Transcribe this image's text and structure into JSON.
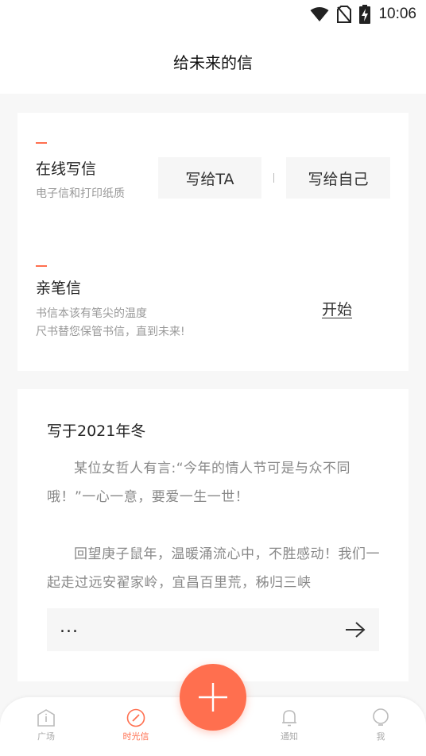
{
  "status": {
    "time": "10:06"
  },
  "header": {
    "title": "给未来的信"
  },
  "online": {
    "title": "在线写信",
    "subtitle": "电子信和打印纸质",
    "write_ta": "写给TA",
    "write_self": "写给自己"
  },
  "handwritten": {
    "title": "亲笔信",
    "subtitle_line1": "书信本该有笔尖的温度",
    "subtitle_line2": "尺书替您保管书信，直到未来!",
    "start": "开始"
  },
  "letter": {
    "title": "写于2021年冬",
    "paragraph1": "某位女哲人有言:“今年的情人节可是与众不同哦！”一心一意，要爱一生一世！",
    "paragraph2": "回望庚子鼠年，温暖涌流心中，不胜感动！我们一起走过远安翟家岭，宜昌百里荒，秭归三峡",
    "more": "..."
  },
  "tabs": [
    {
      "label": "广场",
      "icon": "info-icon"
    },
    {
      "label": "时光信",
      "icon": "compass-icon"
    },
    {
      "label": "通知",
      "icon": "bell-icon"
    },
    {
      "label": "我",
      "icon": "user-icon"
    }
  ],
  "colors": {
    "accent": "#ff6f4f"
  }
}
